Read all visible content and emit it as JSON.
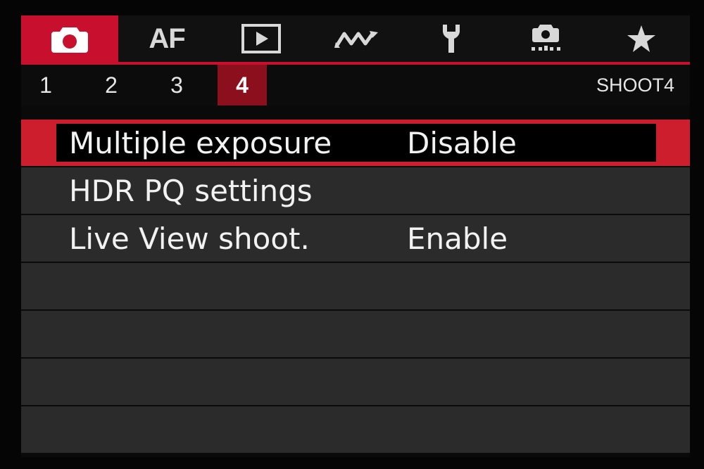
{
  "tabs": [
    {
      "id": "shoot",
      "icon": "camera-icon",
      "active": true
    },
    {
      "id": "af",
      "label": "AF",
      "active": false
    },
    {
      "id": "playback",
      "icon": "playback-icon",
      "active": false
    },
    {
      "id": "wireless",
      "icon": "wireless-icon",
      "active": false
    },
    {
      "id": "setup",
      "icon": "wrench-icon",
      "active": false
    },
    {
      "id": "custom",
      "icon": "custom-functions-icon",
      "active": false
    },
    {
      "id": "mymenu",
      "icon": "star-icon",
      "active": false
    }
  ],
  "pages": [
    "1",
    "2",
    "3",
    "4"
  ],
  "active_page": "4",
  "menu_name": "SHOOT4",
  "items": [
    {
      "label": "Multiple exposure",
      "value": "Disable",
      "selected": true
    },
    {
      "label": "HDR PQ settings",
      "value": "",
      "selected": false
    },
    {
      "label": "Live View shoot.",
      "value": "Enable",
      "selected": false
    }
  ],
  "colors": {
    "accent": "#c8102e",
    "page_active": "#8c0f1d",
    "row_bg": "#2b2b2b"
  }
}
